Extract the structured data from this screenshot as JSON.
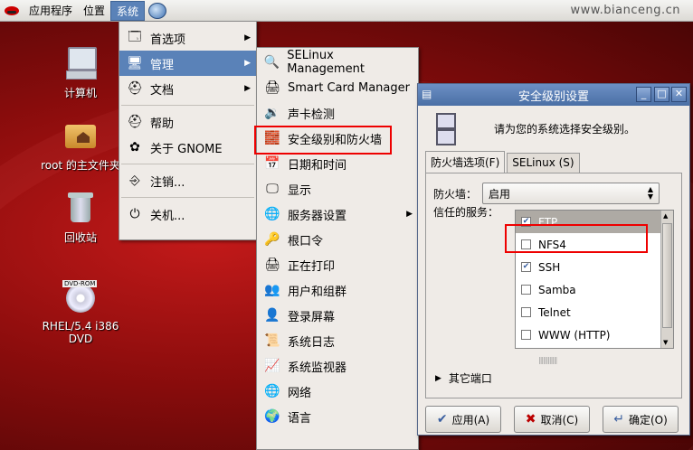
{
  "panel": {
    "apps": "应用程序",
    "places": "位置",
    "system": "系统",
    "watermark": "www.bianceng.cn"
  },
  "desktop": {
    "computer": "计算机",
    "home": "root 的主文件夹",
    "trash": "回收站",
    "dvd": "RHEL/5.4 i386 DVD"
  },
  "system_menu": {
    "items": [
      "首选项",
      "管理",
      "文档",
      "帮助",
      "关于 GNOME",
      "注销...",
      "关机..."
    ]
  },
  "admin_menu": {
    "items": [
      "SELinux Management",
      "Smart Card Manager",
      "声卡检测",
      "安全级别和防火墙",
      "日期和时间",
      "显示",
      "服务器设置",
      "根口令",
      "正在打印",
      "用户和组群",
      "登录屏幕",
      "系统日志",
      "系统监视器",
      "网络",
      "语言"
    ]
  },
  "dialog": {
    "title": "安全级别设置",
    "description": "请为您的系统选择安全级别。",
    "tabs": [
      "防火墙选项(F)",
      "SELinux (S)"
    ],
    "firewall_label": "防火墙：",
    "firewall_value": "启用",
    "trusted_label": "信任的服务：",
    "services": [
      {
        "name": "FTP",
        "checked": true
      },
      {
        "name": "NFS4",
        "checked": false
      },
      {
        "name": "SSH",
        "checked": true
      },
      {
        "name": "Samba",
        "checked": false
      },
      {
        "name": "Telnet",
        "checked": false
      },
      {
        "name": "WWW (HTTP)",
        "checked": false
      }
    ],
    "other_ports": "其它端口",
    "buttons": {
      "apply": "应用(A)",
      "cancel": "取消(C)",
      "ok": "确定(O)"
    }
  },
  "colors": {
    "highlight": "#5a82b8",
    "outline": "#e00000"
  }
}
